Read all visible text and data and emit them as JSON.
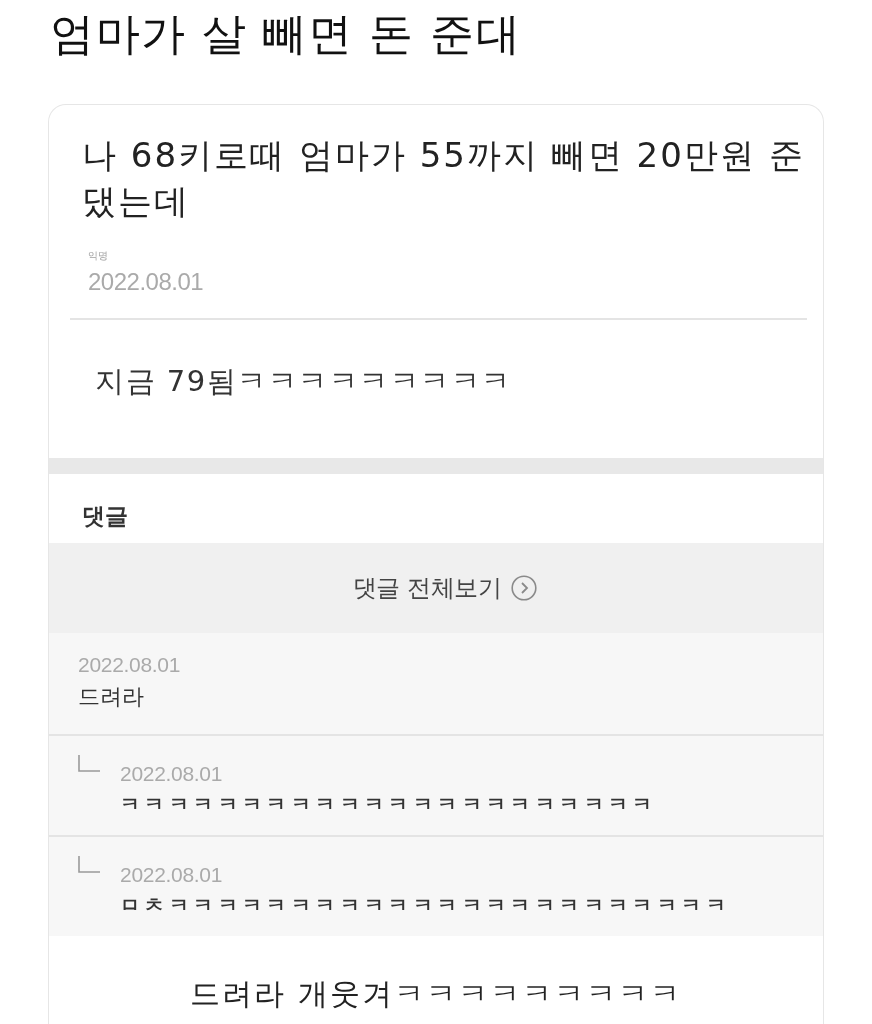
{
  "page_title": "엄마가 살 빼면 돈 준대",
  "post": {
    "title": "나 68키로때 엄마가 55까지 빼면 20만원 준댔는데",
    "author": "익명",
    "date": "2022.08.01",
    "body": "지금 79됨ㅋㅋㅋㅋㅋㅋㅋㅋㅋ"
  },
  "comments": {
    "heading": "댓글",
    "view_all_button": "댓글 전체보기",
    "items": [
      {
        "date": "2022.08.01",
        "text": "드려라",
        "children": [
          {
            "date": "2022.08.01",
            "text": "ㅋㅋㅋㅋㅋㅋㅋㅋㅋㅋㅋㅋㅋㅋㅋㅋㅋㅋㅋㅋㅋㅋ"
          },
          {
            "date": "2022.08.01",
            "text": "ㅁㅊㅋㅋㅋㅋㅋㅋㅋㅋㅋㅋㅋㅋㅋㅋㅋㅋㅋㅋㅋㅋㅋㅋㅋ"
          }
        ]
      }
    ]
  },
  "caption": "드려라 개웃겨ㅋㅋㅋㅋㅋㅋㅋㅋㅋ"
}
